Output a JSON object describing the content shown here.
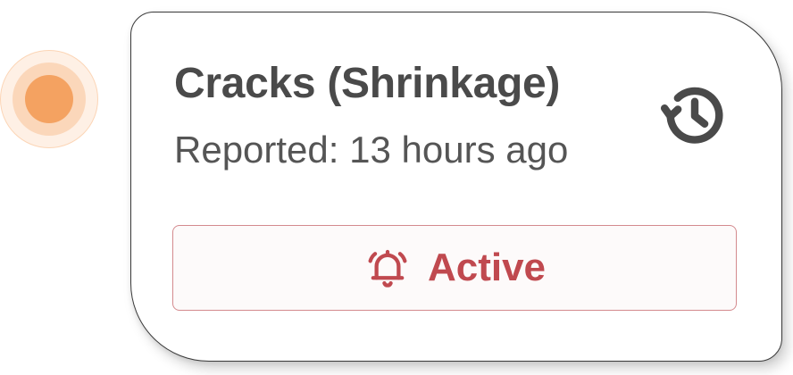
{
  "incident": {
    "title": "Cracks (Shrinkage)",
    "reported": "Reported: 13 hours ago",
    "status_label": "Active",
    "icons": {
      "history": "history-icon",
      "alarm": "alarm-bell-icon"
    }
  },
  "colors": {
    "marker": "#F4A261",
    "status_text": "#C0494F",
    "status_border": "#D48A8E",
    "title_text": "#4A4A4A"
  }
}
